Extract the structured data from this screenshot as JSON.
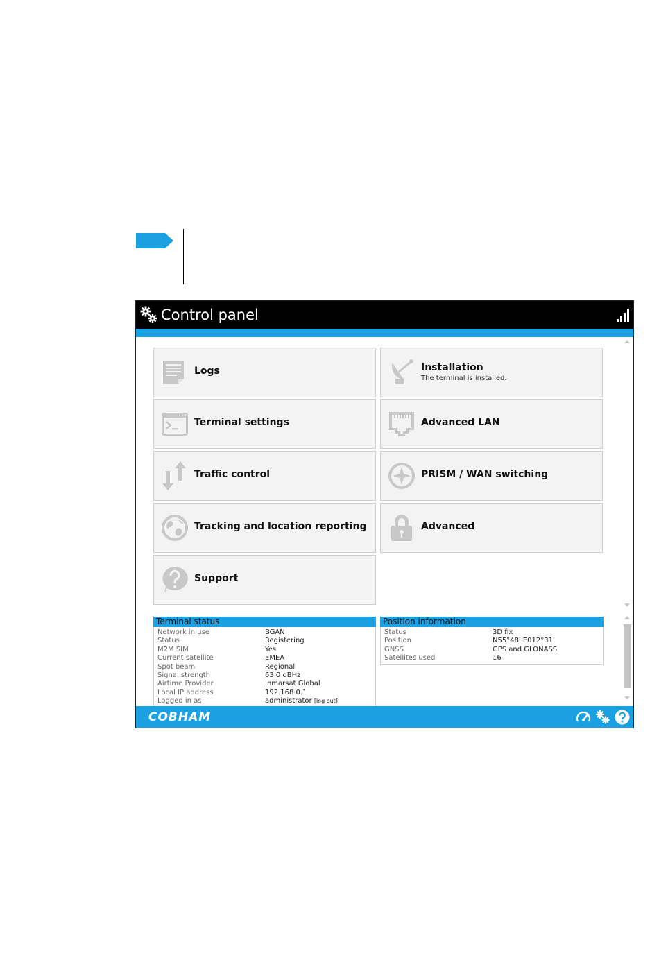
{
  "window": {
    "title": "Control panel"
  },
  "tiles": [
    {
      "label": "Logs",
      "icon": "logs-icon"
    },
    {
      "label": "Installation",
      "sub": "The terminal is installed.",
      "icon": "satellite-dish-icon"
    },
    {
      "label": "Terminal settings",
      "icon": "terminal-icon"
    },
    {
      "label": "Advanced LAN",
      "icon": "ethernet-port-icon"
    },
    {
      "label": "Traffic control",
      "icon": "up-down-arrows-icon"
    },
    {
      "label": "PRISM / WAN switching",
      "icon": "compass-icon"
    },
    {
      "label": "Tracking and location reporting",
      "icon": "globe-icon"
    },
    {
      "label": "Advanced",
      "icon": "lock-icon"
    },
    {
      "label": "Support",
      "icon": "question-icon"
    }
  ],
  "terminal_status": {
    "title": "Terminal status",
    "rows": [
      {
        "k": "Network in use",
        "v": "BGAN"
      },
      {
        "k": "Status",
        "v": "Registering"
      },
      {
        "k": "M2M SIM",
        "v": "Yes"
      },
      {
        "k": "Current satellite",
        "v": "EMEA"
      },
      {
        "k": "Spot beam",
        "v": "Regional"
      },
      {
        "k": "Signal strength",
        "v": "63.0 dBHz"
      },
      {
        "k": "Airtime Provider",
        "v": "Inmarsat Global"
      },
      {
        "k": "Local IP address",
        "v": "192.168.0.1"
      },
      {
        "k": "Logged in as",
        "v": "administrator"
      }
    ],
    "logout_label": "[log out]"
  },
  "position_info": {
    "title": "Position information",
    "rows": [
      {
        "k": "Status",
        "v": "3D fix"
      },
      {
        "k": "Position",
        "v": "N55°48' E012°31'"
      },
      {
        "k": "GNSS",
        "v": "GPS and GLONASS"
      },
      {
        "k": "Satellites used",
        "v": "16"
      }
    ]
  },
  "footer": {
    "brand": "COBHAM"
  },
  "colors": {
    "accent": "#1ba0e2",
    "titlebar": "#000000",
    "tile_bg": "#f3f3f3",
    "icon_gray": "#c8c8c8"
  }
}
